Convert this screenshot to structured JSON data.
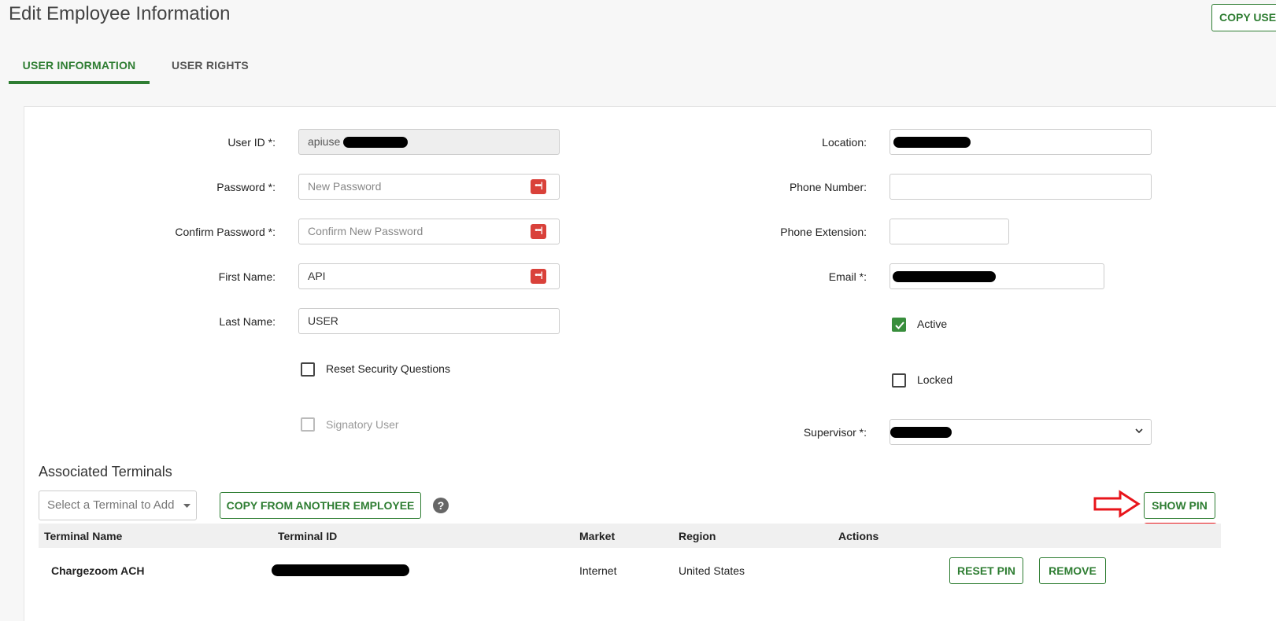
{
  "page": {
    "title": "Edit Employee Information",
    "copy_user_label": "COPY USER"
  },
  "tabs": [
    {
      "label": "USER INFORMATION",
      "active": true
    },
    {
      "label": "USER RIGHTS",
      "active": false
    }
  ],
  "form": {
    "user_id": {
      "label": "User ID *:",
      "value": "apiuse"
    },
    "password": {
      "label": "Password *:",
      "placeholder": "New Password"
    },
    "confirm_password": {
      "label": "Confirm Password *:",
      "placeholder": "Confirm New Password"
    },
    "first_name": {
      "label": "First Name:",
      "value": "API"
    },
    "last_name": {
      "label": "Last Name:",
      "value": "USER"
    },
    "reset_security_questions": {
      "label": "Reset Security Questions",
      "checked": false
    },
    "signatory_user": {
      "label": "Signatory User",
      "checked": false,
      "disabled": true
    },
    "location": {
      "label": "Location:"
    },
    "phone_number": {
      "label": "Phone Number:",
      "value": ""
    },
    "phone_extension": {
      "label": "Phone Extension:",
      "value": ""
    },
    "email": {
      "label": "Email *:"
    },
    "active": {
      "label": "Active",
      "checked": true
    },
    "locked": {
      "label": "Locked",
      "checked": false
    },
    "supervisor": {
      "label": "Supervisor *:"
    }
  },
  "terminals": {
    "section_title": "Associated Terminals",
    "select_placeholder": "Select a Terminal to Add",
    "copy_from_label": "COPY FROM ANOTHER EMPLOYEE",
    "help_glyph": "?",
    "show_pin_label": "SHOW PIN",
    "columns": [
      "Terminal Name",
      "Terminal ID",
      "Market",
      "Region",
      "Actions"
    ],
    "rows": [
      {
        "name": "Chargezoom ACH",
        "market": "Internet",
        "region": "United States",
        "reset_pin_label": "RESET PIN",
        "remove_label": "REMOVE"
      }
    ]
  },
  "colors": {
    "accent": "#2e7d32",
    "annotation": "#e8151b",
    "password_icon": "#d9413a"
  },
  "icons": [
    "password-manager-icon",
    "chevron-down-icon",
    "help-icon",
    "check-icon",
    "annotation-arrow-icon"
  ]
}
